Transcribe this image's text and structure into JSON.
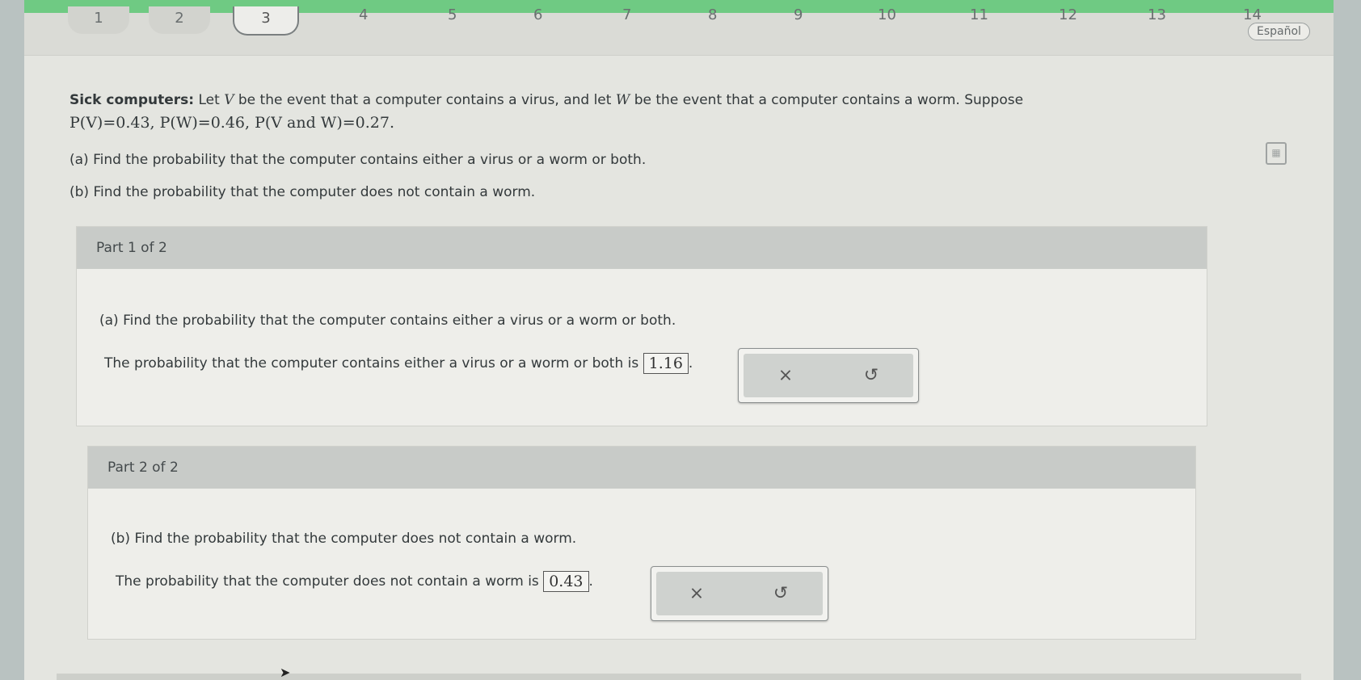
{
  "nav": {
    "tabs": [
      "1",
      "2",
      "3",
      "4",
      "5",
      "6",
      "7",
      "8",
      "9",
      "10",
      "11",
      "12",
      "13",
      "14"
    ],
    "language_button": "Español"
  },
  "problem": {
    "title": "Sick computers:",
    "intro_1": "Let",
    "var_v": "V",
    "intro_2": "be the event that a computer contains a virus, and let",
    "var_w": "W",
    "intro_3": "be the event that a computer contains a worm. Suppose",
    "given": "P(V)=0.43, P(W)=0.46, P(V and W)=0.27.",
    "question_a": "(a) Find the probability that the computer contains either a virus or a worm or both.",
    "question_b": "(b) Find the probability that the computer does not contain a worm."
  },
  "part1": {
    "header": "Part 1 of 2",
    "question": "(a) Find the probability that the computer contains either a virus or a worm or both.",
    "answer_prefix": "The probability that the computer contains either a virus or a worm or both is",
    "answer_value": "1.16",
    "answer_suffix": "."
  },
  "part2": {
    "header": "Part 2 of 2",
    "question": "(b) Find the probability that the computer does not contain a worm.",
    "answer_prefix": "The probability that the computer does not contain a worm is",
    "answer_value": "0.43",
    "answer_suffix": "."
  },
  "icons": {
    "clear": "×",
    "undo": "↺"
  }
}
